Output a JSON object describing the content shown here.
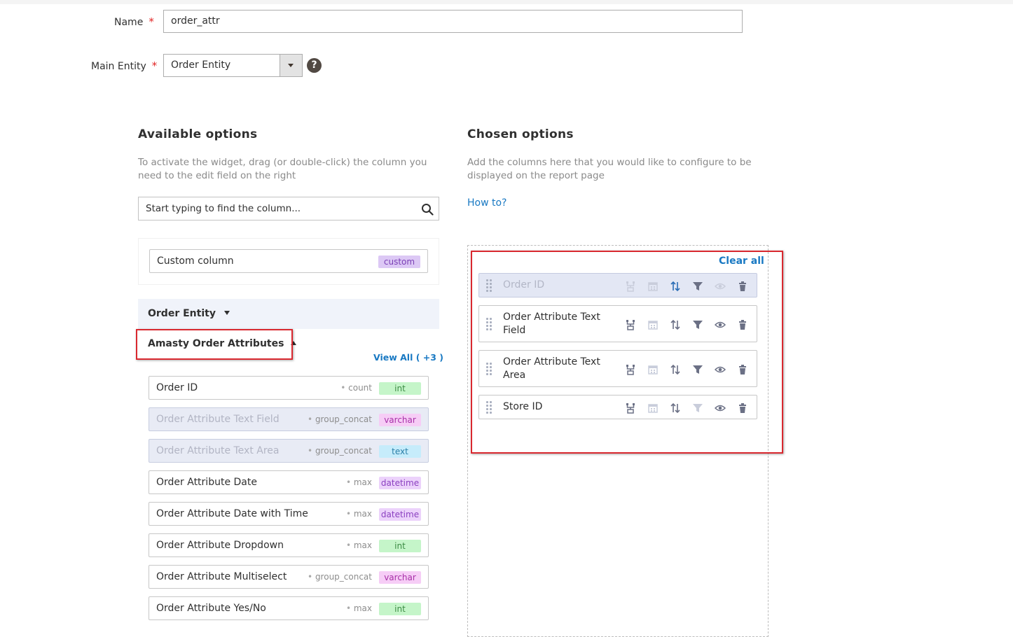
{
  "form": {
    "name_label": "Name",
    "name_value": "order_attr",
    "main_entity_label": "Main Entity",
    "main_entity_value": "Order Entity",
    "required_mark": "*",
    "help_glyph": "?"
  },
  "available": {
    "title": "Available options",
    "description": "To activate the widget, drag (or double-click) the column you need to the edit field on the right",
    "search_placeholder": "Start typing to find the column...",
    "custom_column": {
      "label": "Custom column",
      "badge": "custom"
    },
    "entity_group": "Order Entity",
    "attributes_group": "Amasty Order Attributes",
    "view_all": "View All ( +3 )",
    "columns": [
      {
        "label": "Order ID",
        "agg": "count",
        "type": "int",
        "disabled": false
      },
      {
        "label": "Order Attribute Text Field",
        "agg": "group_concat",
        "type": "varchar",
        "disabled": true
      },
      {
        "label": "Order Attribute Text Area",
        "agg": "group_concat",
        "type": "text",
        "disabled": true
      },
      {
        "label": "Order Attribute Date",
        "agg": "max",
        "type": "datetime",
        "disabled": false
      },
      {
        "label": "Order Attribute Date with Time",
        "agg": "max",
        "type": "datetime",
        "disabled": false
      },
      {
        "label": "Order Attribute Dropdown",
        "agg": "max",
        "type": "int",
        "disabled": false
      },
      {
        "label": "Order Attribute Multiselect",
        "agg": "group_concat",
        "type": "varchar",
        "disabled": false
      },
      {
        "label": "Order Attribute Yes/No",
        "agg": "max",
        "type": "int",
        "disabled": false
      }
    ]
  },
  "chosen": {
    "title": "Chosen options",
    "description": "Add the columns here that you would like to configure to be displayed on the report page",
    "how_to": "How to?",
    "clear_all": "Clear all",
    "items": [
      {
        "line1": "Order ID",
        "line2": "",
        "disabled": true
      },
      {
        "line1": "Order Attribute Text",
        "line2": "Field",
        "disabled": false
      },
      {
        "line1": "Order Attribute Text",
        "line2": "Area",
        "disabled": false
      },
      {
        "line1": "Store ID",
        "line2": "",
        "disabled": false
      }
    ]
  },
  "colors": {
    "link": "#1979c3",
    "highlight": "#d9282f",
    "badge_custom": "#dcc8f5",
    "badge_int": "#c5f5c9",
    "badge_varchar": "#f6cdf6",
    "badge_text": "#c6ecfb",
    "badge_datetime": "#ecd2fb"
  }
}
